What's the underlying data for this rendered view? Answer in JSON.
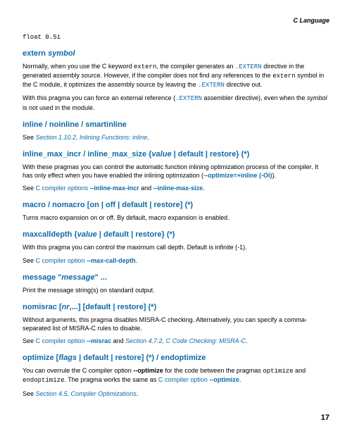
{
  "breadcrumb": "C Language",
  "code_sample": "float 0.5i",
  "h_extern_kw": "extern",
  "h_extern_sym": " symbol",
  "p_extern_1a": "Normally, when you use the C keyword ",
  "kw_extern": "extern",
  "p_extern_1b": ", the compiler generates an ",
  "dir_extern1": ".EXTERN",
  "p_extern_1c": " directive in the generated assembly source. However, if the compiler does not find any references to the ",
  "p_extern_1d": " symbol in the C module, it optimizes the assembly source by leaving the ",
  "dir_extern2": ".EXTERN",
  "p_extern_1e": " directive out.",
  "p_extern_2a": "With this pragma you can force an external reference (",
  "dir_extern3": ".EXTERN",
  "p_extern_2b": " assembler directive), even when the ",
  "sym_text": "symbol",
  "p_extern_2c": " is not used in the module.",
  "h_inline": "inline / noinline / smartinline",
  "p_inline_a": "See ",
  "p_inline_link": "Section 1.10.2, Inlining Functions: inline",
  "p_inline_b": ".",
  "h_inline_max_a": "inline_max_incr / inline_max_size {",
  "h_inline_max_val": "value",
  "h_inline_max_b": " | default | restore}  (*)",
  "p_inlinemax_1": "With these pragmas you can control the automatic function inlining optimization process of the compiler. It has only effect when you have enabled the inlining optimization (",
  "p_inlinemax_link1": "--optimize=+inline (-Oi)",
  "p_inlinemax_1b": ").",
  "p_inlinemax_2a": "See ",
  "p_inlinemax_link2": "C compiler options",
  "p_inlinemax_2b": " ",
  "p_inlinemax_link3": "--inline-max-incr",
  "p_inlinemax_2c": " and ",
  "p_inlinemax_link4": "--inline-max-size",
  "p_inlinemax_2d": ".",
  "h_macro": "macro / nomacro [on | off | default | restore]  (*)",
  "p_macro": "Turns macro expansion on or off. By default, macro expansion is enabled.",
  "h_maxcall_a": "maxcalldepth {",
  "h_maxcall_val": "value",
  "h_maxcall_b": " | default | restore}  (*)",
  "p_maxcall_1": "With this pragma you can control the maximum call depth. Default is infinite (-1).",
  "p_maxcall_2a": "See ",
  "p_maxcall_link1": "C compiler option",
  "p_maxcall_2b": " ",
  "p_maxcall_link2": "--max-call-depth",
  "p_maxcall_2c": ".",
  "h_message_a": "message \"",
  "h_message_val": "message",
  "h_message_b": "\" ...",
  "p_message": "Print the message string(s) on standard output.",
  "h_nomisrac_a": "nomisrac [",
  "h_nomisrac_val": "nr",
  "h_nomisrac_b": ",...] [default | restore]  (*)",
  "p_nomisrac_1": "Without arguments, this pragma disables MISRA-C checking. Alternatively, you can specify a comma-separated list of MISRA-C rules to disable.",
  "p_nomisrac_2a": "See ",
  "p_nomisrac_link1": "C compiler option",
  "p_nomisrac_2b": " ",
  "p_nomisrac_link2": "--misrac",
  "p_nomisrac_2c": " and ",
  "p_nomisrac_link3": "Section 4.7.2, C Code Checking: MISRA-C",
  "p_nomisrac_2d": ".",
  "h_optimize_a": "optimize [",
  "h_optimize_val": "flags",
  "h_optimize_b": " | default | restore]  (*) / endoptimize",
  "p_optimize_1a": "You can overrule the C compiler option ",
  "p_optimize_bold1": "--optimize",
  "p_optimize_1b": " for the code between the pragmas ",
  "kw_optimize": "optimize",
  "p_optimize_1c": " and ",
  "kw_endoptimize": "endoptimize",
  "p_optimize_1d": ". The pragma works the same as ",
  "p_optimize_link1": "C compiler option",
  "p_optimize_1e": " ",
  "p_optimize_link2": "--optimize",
  "p_optimize_1f": ".",
  "p_optimize_2a": "See ",
  "p_optimize_link3": "Section 4.5, Compiler Optimizations",
  "p_optimize_2b": ".",
  "page_number": "17"
}
